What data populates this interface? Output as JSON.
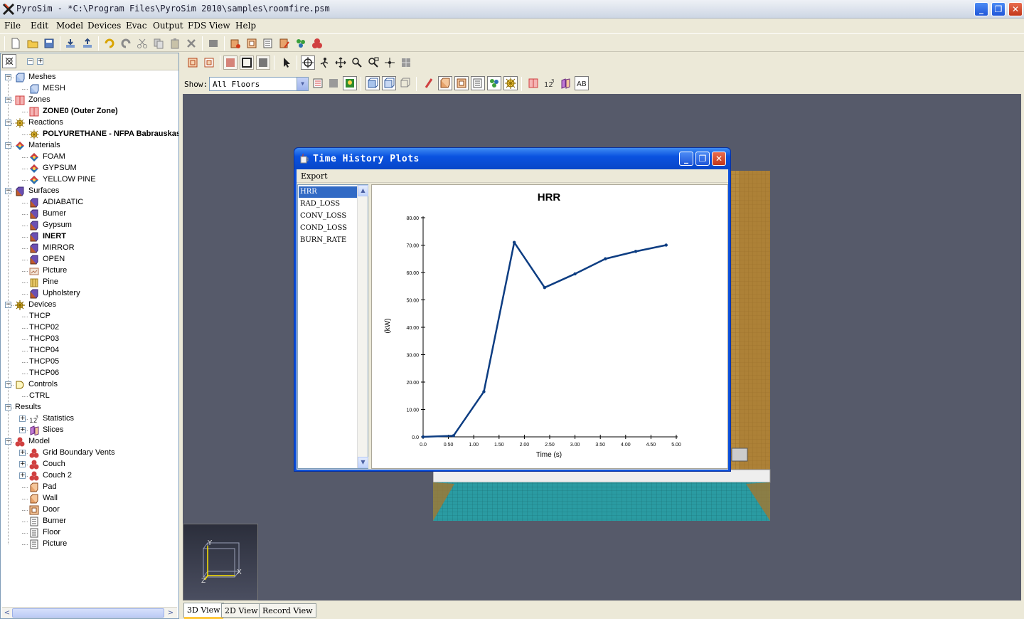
{
  "window": {
    "title": "PyroSim - *C:\\Program Files\\PyroSim 2010\\samples\\roomfire.psm",
    "min": "_",
    "max": "❐",
    "close": "✕"
  },
  "menu": [
    "File",
    "Edit",
    "Model",
    "Devices",
    "Evac",
    "Output",
    "FDS",
    "View",
    "Help"
  ],
  "tree": [
    {
      "level": 0,
      "label": "Meshes",
      "icon": "mesh-icon",
      "expanded": true,
      "bold": false
    },
    {
      "level": 1,
      "label": "MESH",
      "icon": "mesh-icon",
      "bold": false
    },
    {
      "level": 0,
      "label": "Zones",
      "icon": "zone-icon",
      "expanded": true,
      "bold": false
    },
    {
      "level": 1,
      "label": "ZONE0 (Outer Zone)",
      "icon": "zone-icon",
      "bold": true
    },
    {
      "level": 0,
      "label": "Reactions",
      "icon": "reaction-icon",
      "expanded": true,
      "bold": false
    },
    {
      "level": 1,
      "label": "POLYURETHANE - NFPA Babrauskas",
      "icon": "reaction-icon",
      "bold": true
    },
    {
      "level": 0,
      "label": "Materials",
      "icon": "material-icon",
      "expanded": true,
      "bold": false
    },
    {
      "level": 1,
      "label": "FOAM",
      "icon": "material-icon",
      "bold": false
    },
    {
      "level": 1,
      "label": "GYPSUM",
      "icon": "material-icon",
      "bold": false
    },
    {
      "level": 1,
      "label": "YELLOW PINE",
      "icon": "material-icon",
      "bold": false
    },
    {
      "level": 0,
      "label": "Surfaces",
      "icon": "surface-icon",
      "expanded": true,
      "bold": false
    },
    {
      "level": 1,
      "label": "ADIABATIC",
      "icon": "surface-icon",
      "bold": false
    },
    {
      "level": 1,
      "label": "Burner",
      "icon": "surface-icon",
      "bold": false
    },
    {
      "level": 1,
      "label": "Gypsum",
      "icon": "surface-icon",
      "bold": false
    },
    {
      "level": 1,
      "label": "INERT",
      "icon": "surface-icon",
      "bold": true
    },
    {
      "level": 1,
      "label": "MIRROR",
      "icon": "surface-icon",
      "bold": false
    },
    {
      "level": 1,
      "label": "OPEN",
      "icon": "surface-icon",
      "bold": false
    },
    {
      "level": 1,
      "label": "Picture",
      "icon": "picture-icon",
      "bold": false
    },
    {
      "level": 1,
      "label": "Pine",
      "icon": "pine-icon",
      "bold": false
    },
    {
      "level": 1,
      "label": "Upholstery",
      "icon": "surface-icon",
      "bold": false
    },
    {
      "level": 0,
      "label": "Devices",
      "icon": "device-icon",
      "expanded": true,
      "bold": false
    },
    {
      "level": 1,
      "label": "THCP",
      "icon": "",
      "bold": false
    },
    {
      "level": 1,
      "label": "THCP02",
      "icon": "",
      "bold": false
    },
    {
      "level": 1,
      "label": "THCP03",
      "icon": "",
      "bold": false
    },
    {
      "level": 1,
      "label": "THCP04",
      "icon": "",
      "bold": false
    },
    {
      "level": 1,
      "label": "THCP05",
      "icon": "",
      "bold": false
    },
    {
      "level": 1,
      "label": "THCP06",
      "icon": "",
      "bold": false
    },
    {
      "level": 0,
      "label": "Controls",
      "icon": "control-icon",
      "expanded": true,
      "bold": false
    },
    {
      "level": 1,
      "label": "CTRL",
      "icon": "",
      "bold": false
    },
    {
      "level": 0,
      "label": "Results",
      "icon": "",
      "expanded": true,
      "bold": false
    },
    {
      "level": 1,
      "label": "Statistics",
      "icon": "statistics-icon",
      "expander": "+",
      "bold": false
    },
    {
      "level": 1,
      "label": "Slices",
      "icon": "slice-icon",
      "expander": "+",
      "bold": false
    },
    {
      "level": 0,
      "label": "Model",
      "icon": "model-icon",
      "expanded": true,
      "bold": false
    },
    {
      "level": 1,
      "label": "Grid Boundary Vents",
      "icon": "model-icon",
      "expander": "+",
      "bold": false
    },
    {
      "level": 1,
      "label": "Couch",
      "icon": "model-icon",
      "expander": "+",
      "bold": false
    },
    {
      "level": 1,
      "label": "Couch 2",
      "icon": "model-icon",
      "expander": "+",
      "bold": false
    },
    {
      "level": 1,
      "label": "Pad",
      "icon": "obstruction-icon",
      "bold": false
    },
    {
      "level": 1,
      "label": "Wall",
      "icon": "obstruction-icon",
      "bold": false
    },
    {
      "level": 1,
      "label": "Door",
      "icon": "hole-icon",
      "bold": false
    },
    {
      "level": 1,
      "label": "Burner",
      "icon": "vent-icon",
      "bold": false
    },
    {
      "level": 1,
      "label": "Floor",
      "icon": "vent-icon",
      "bold": false
    },
    {
      "level": 1,
      "label": "Picture",
      "icon": "vent-icon",
      "bold": false
    }
  ],
  "view_toolbar": {
    "show_label": "Show:",
    "show_value": "All Floors"
  },
  "bottom_tabs": [
    "3D View",
    "2D View",
    "Record View"
  ],
  "axes": {
    "x": "X",
    "y": "Y",
    "z": "Z"
  },
  "dialog": {
    "title": "Time History Plots",
    "menu_export": "Export",
    "series": [
      "HRR",
      "RAD_LOSS",
      "CONV_LOSS",
      "COND_LOSS",
      "BURN_RATE"
    ],
    "selected_series": "HRR"
  },
  "colors": {
    "line": "#0d3d82",
    "viewport_bg": "#565a6a",
    "dialog_title": "#0a52e0"
  },
  "chart_data": {
    "type": "line",
    "title": "HRR",
    "xlabel": "Time (s)",
    "ylabel": "(kW)",
    "xlim": [
      0,
      5
    ],
    "ylim": [
      0,
      80
    ],
    "x_ticks": [
      "0.0",
      "0.50",
      "1.00",
      "1.50",
      "2.00",
      "2.50",
      "3.00",
      "3.50",
      "4.00",
      "4.50",
      "5.00"
    ],
    "y_ticks": [
      "0.0",
      "10.00",
      "20.00",
      "30.00",
      "40.00",
      "50.00",
      "60.00",
      "70.00",
      "80.00"
    ],
    "series": [
      {
        "x": [
          0.0,
          0.6,
          1.2,
          1.8,
          2.4,
          3.0,
          3.6,
          4.2,
          4.8
        ],
        "values": [
          0.0,
          0.4,
          16.5,
          71.0,
          54.5,
          59.5,
          65.0,
          67.7,
          70.0
        ]
      }
    ],
    "grid": false,
    "legend": "none"
  }
}
